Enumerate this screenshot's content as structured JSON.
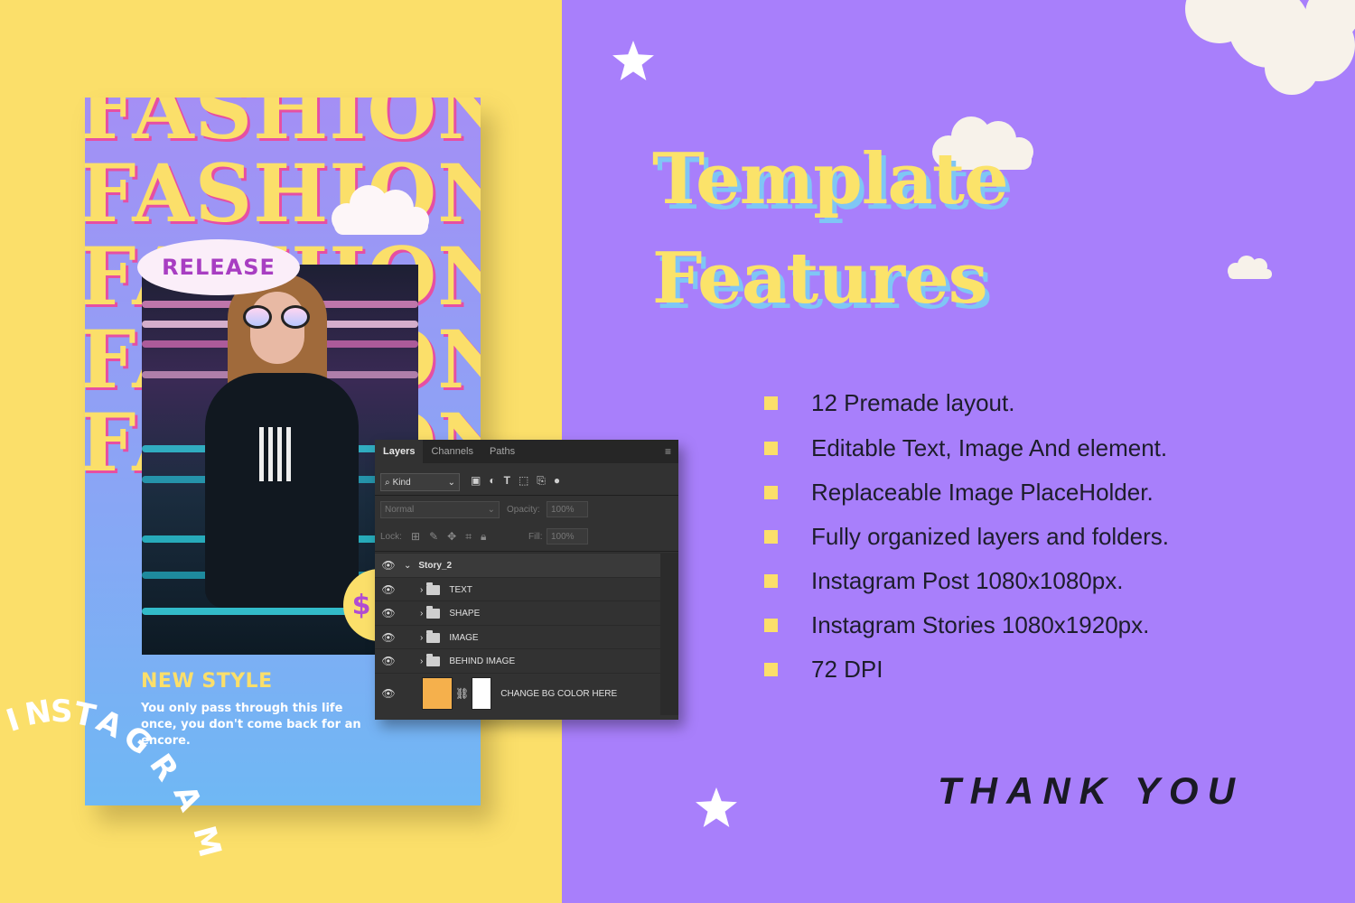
{
  "story": {
    "fashion_word": "FASHION",
    "release_label": "RELEASE",
    "price_symbol": "$",
    "new_style_title": "NEW STYLE",
    "new_style_body": "You only pass through this life once, you don't come back for an encore."
  },
  "instagram_text": "INSTAGRAM",
  "photoshop_panel": {
    "tabs": [
      "Layers",
      "Channels",
      "Paths"
    ],
    "menu_icon": "panel-menu-icon",
    "filter_kind": "Kind",
    "blend_mode": "Normal",
    "opacity_label": "Opacity:",
    "opacity_value": "100%",
    "lock_label": "Lock:",
    "fill_label": "Fill:",
    "fill_value": "100%",
    "group_name": "Story_2",
    "layers": [
      "TEXT",
      "SHAPE",
      "IMAGE",
      "BEHIND IMAGE"
    ],
    "bg_layer_name": "CHANGE BG COLOR HERE",
    "bg_swatch_color": "#f5b04c"
  },
  "heading": {
    "line1": "Template",
    "line2": "Features"
  },
  "features": [
    "12 Premade layout.",
    "Editable Text, Image And element.",
    "Replaceable Image PlaceHolder.",
    "Fully organized layers and folders.",
    "Instagram Post 1080x1080px.",
    "Instagram Stories 1080x1920px.",
    "72 DPI"
  ],
  "thank_you": "THANK YOU",
  "colors": {
    "yellow": "#fbdf6a",
    "purple": "#a87ffb",
    "heading_shadow": "#7fc6f5",
    "accent_pink": "#e64fa3"
  }
}
